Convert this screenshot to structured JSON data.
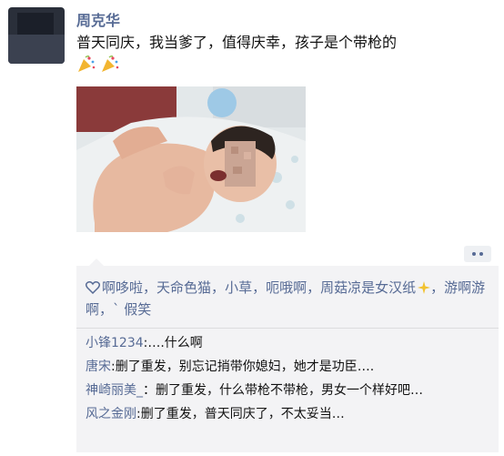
{
  "post": {
    "author": "周克华",
    "text": "普天同庆，我当爹了，值得庆幸，孩子是个带枪的"
  },
  "likes": {
    "names": [
      "啊哆啦",
      "天命色猫",
      "小草",
      "呃哦啊",
      "周菇凉是女汉纸",
      "游啊游啊",
      "` 假笑"
    ],
    "separator": "，"
  },
  "comments": [
    {
      "author": "小锋1234",
      "sep": ":",
      "text": "….什么啊"
    },
    {
      "author": "唐宋",
      "sep": ":",
      "text": "删了重发，别忘记捎带你媳妇，她才是功臣…."
    },
    {
      "author": "神崎丽美_",
      "sep": "：",
      "text": "删了重发，什么带枪不带枪，男女一个样好吧…"
    },
    {
      "author": "风之金刚",
      "sep": ":",
      "text": "删了重发，普天同庆了，不太妥当…"
    }
  ],
  "colors": {
    "name": "#576b95",
    "comment_bg": "#f3f3f5"
  },
  "icons": {
    "emoji": "party-popper-icon",
    "like": "heart-icon",
    "sparkle": "sparkles-icon",
    "more": "more-dots-icon"
  }
}
